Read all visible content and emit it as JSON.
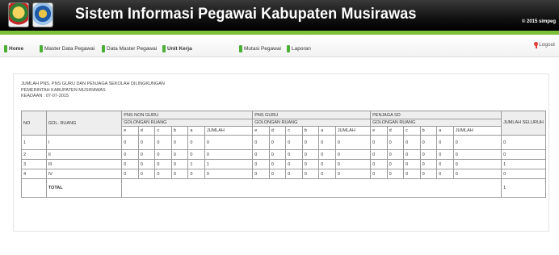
{
  "header": {
    "title": "Sistem Informasi Pegawai Kabupaten Musirawas",
    "copyright": "© 2015 simpeg"
  },
  "nav": {
    "items": [
      {
        "label": "Home",
        "bold": true
      },
      {
        "label": "Master Data Pegawai",
        "bold": false
      },
      {
        "label": "Data Master Pegawai",
        "bold": false
      },
      {
        "label": "Unit Kerja",
        "bold": true
      },
      {
        "label": "Mutasi Pegawai",
        "bold": false
      },
      {
        "label": "Laporan",
        "bold": false
      }
    ],
    "logout_label": "Logout"
  },
  "report": {
    "line1": "JUMLAH PNS, PNS GURU DAN PENJAGA SEKOLAH DILINGKUNGAN",
    "line2": "PEMERINTAH KABUPATEN MUSIRAWAS",
    "line3": "KEADAAN : 07-07-2015"
  },
  "table": {
    "col_no": "NO",
    "col_gol": "GOL. RUANG",
    "groups": [
      "PNS NON GURU",
      "PNS GURU",
      "PENJAGA SD"
    ],
    "sub_header": "GOLONGAN RUANG",
    "col_total": "JUMLAH SELURUH",
    "sub_cols": [
      "e",
      "d",
      "c",
      "b",
      "a",
      "JUMLAH"
    ],
    "rows": [
      {
        "no": "1",
        "gol": "I",
        "values": [
          "0",
          "0",
          "0",
          "0",
          "0",
          "0",
          "0",
          "0",
          "0",
          "0",
          "0",
          "0",
          "0",
          "0",
          "0",
          "0",
          "0",
          "0"
        ],
        "total": "0"
      },
      {
        "no": "2",
        "gol": "II",
        "values": [
          "0",
          "0",
          "0",
          "0",
          "0",
          "0",
          "0",
          "0",
          "0",
          "0",
          "0",
          "0",
          "0",
          "0",
          "0",
          "0",
          "0",
          "0"
        ],
        "total": "0"
      },
      {
        "no": "3",
        "gol": "III",
        "values": [
          "0",
          "0",
          "0",
          "0",
          "1",
          "1",
          "0",
          "0",
          "0",
          "0",
          "0",
          "0",
          "0",
          "0",
          "0",
          "0",
          "0",
          "0"
        ],
        "total": "1"
      },
      {
        "no": "4",
        "gol": "IV",
        "values": [
          "0",
          "0",
          "0",
          "0",
          "0",
          "0",
          "0",
          "0",
          "0",
          "0",
          "0",
          "0",
          "0",
          "0",
          "0",
          "0",
          "0",
          "0"
        ],
        "total": "0"
      }
    ],
    "total_label": "TOTAL",
    "grand_total": "1"
  },
  "colors": {
    "header_bg": "#000000",
    "accent_green": "#7bbf3a",
    "nav_icon": "#4caf35",
    "logout_icon": "#e53935"
  }
}
